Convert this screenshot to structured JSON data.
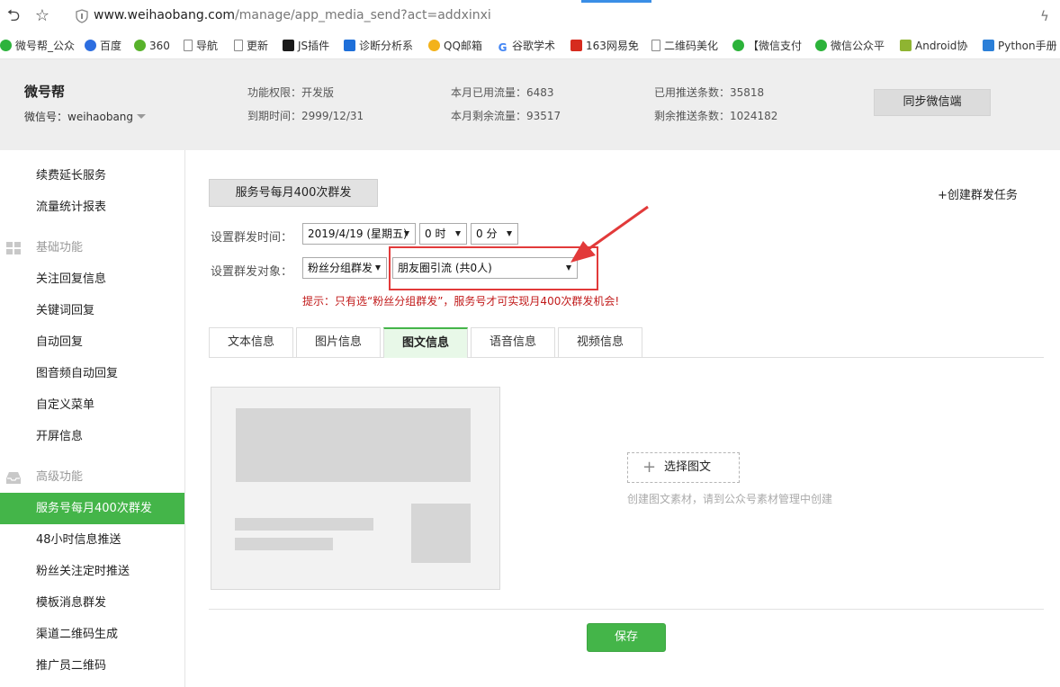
{
  "browser": {
    "url_domain": "www.weihaobang.com",
    "url_path": "/manage/app_media_send?act=addxinxi",
    "bookmarks": [
      {
        "label": "微号帮_公众",
        "icon": "wechat-green-icon"
      },
      {
        "label": "百度",
        "icon": "baidu-paw-icon"
      },
      {
        "label": "360",
        "icon": "360-icon"
      },
      {
        "label": "导航",
        "icon": "page-icon"
      },
      {
        "label": "更新",
        "icon": "page-icon"
      },
      {
        "label": "JS插件",
        "icon": "js-icon"
      },
      {
        "label": "诊断分析系",
        "icon": "diagnosis-icon"
      },
      {
        "label": "QQ邮箱",
        "icon": "qq-mail-icon"
      },
      {
        "label": "谷歌学术",
        "icon": "google-icon"
      },
      {
        "label": "163网易免",
        "icon": "163-icon"
      },
      {
        "label": "二维码美化",
        "icon": "page-icon"
      },
      {
        "label": "【微信支付",
        "icon": "wechat-icon"
      },
      {
        "label": "微信公众平",
        "icon": "wechat-icon"
      },
      {
        "label": "Android协",
        "icon": "android-icon"
      },
      {
        "label": "Python手册",
        "icon": "python-icon"
      }
    ]
  },
  "header": {
    "brand": "微号帮",
    "wechat_id": "微信号：weihaobang",
    "permission": "功能权限：开发版",
    "expire": "到期时间：2999/12/31",
    "used_traffic": "本月已用流量：6483",
    "remaining_traffic": "本月剩余流量：93517",
    "used_push": "已用推送条数：35818",
    "remaining_push": "剩余推送条数：1024182",
    "sync_button": "同步微信端"
  },
  "sidebar": {
    "items_top": [
      "续费延长服务",
      "流量统计报表"
    ],
    "group_basic": "基础功能",
    "items_basic": [
      "关注回复信息",
      "关键词回复",
      "自动回复",
      "图音频自动回复",
      "自定义菜单",
      "开屏信息"
    ],
    "group_advanced": "高级功能",
    "items_advanced": [
      "服务号每月400次群发",
      "48小时信息推送",
      "粉丝关注定时推送",
      "模板消息群发",
      "渠道二维码生成",
      "推广员二维码"
    ],
    "active_item": "服务号每月400次群发"
  },
  "main": {
    "task_tab": "服务号每月400次群发",
    "create_task": "+创建群发任务",
    "time_label": "设置群发时间：",
    "date_select": "2019/4/19 (星期五)",
    "hour_select": "0 时",
    "minute_select": "0 分",
    "target_label": "设置群发对象：",
    "target_type_select": "粉丝分组群发",
    "group_select": "朋友圈引流  (共0人)",
    "tip": "提示：只有选“粉丝分组群发”，服务号才可实现月400次群发机会!",
    "tabs": [
      "文本信息",
      "图片信息",
      "图文信息",
      "语音信息",
      "视频信息"
    ],
    "active_tab": "图文信息",
    "choose_button": "选择图文",
    "choose_hint": "创建图文素材，请到公众号素材管理中创建",
    "save_button": "保存"
  },
  "colors": {
    "accent_green": "#44b549",
    "highlight_red": "#e23a3a",
    "tip_red": "#c11a1a"
  }
}
